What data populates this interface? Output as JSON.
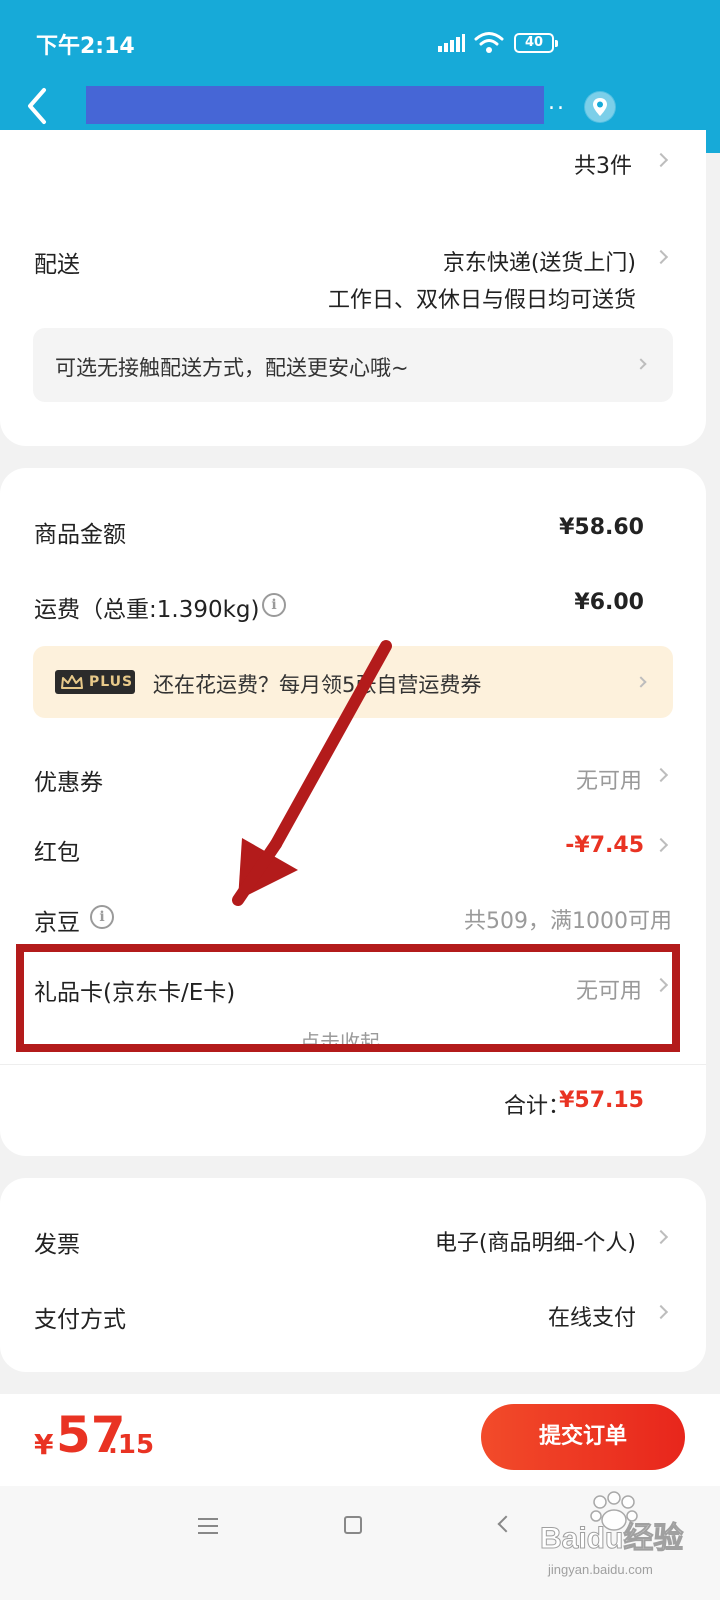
{
  "status_bar": {
    "time": "下午2:14",
    "battery": "40"
  },
  "header": {
    "ellipsis": "..",
    "icons": [
      "back-icon",
      "location-icon"
    ]
  },
  "items_section": {
    "count": "共3件"
  },
  "delivery": {
    "label": "配送",
    "method": "京东快递(送货上门)",
    "schedule": "工作日、双休日与假日均可送货",
    "tip": "可选无接触配送方式，配送更安心哦~"
  },
  "fees": {
    "goods_label": "商品金额",
    "goods_value": "¥58.60",
    "shipping_label": "运费（总重:1.390kg)",
    "shipping_value": "¥6.00",
    "plus_badge": "PLUS",
    "plus_text": "还在花运费？每月领5张自营运费券",
    "coupon_label": "优惠券",
    "coupon_value": "无可用",
    "redpacket_label": "红包",
    "redpacket_value": "-¥7.45",
    "jingdou_label": "京豆",
    "jingdou_value": "共509，满1000可用",
    "giftcard_label": "礼品卡(京东卡/E卡)",
    "giftcard_value": "无可用",
    "collapse_text": "点击收起",
    "total_label": "合计：",
    "total_value": "¥57.15"
  },
  "invoice": {
    "label": "发票",
    "value": "电子(商品明细-个人)",
    "pay_label": "支付方式",
    "pay_value": "在线支付"
  },
  "bottom": {
    "yen": "¥",
    "amount_int": "57",
    "amount_dec": ".15",
    "submit_label": "提交订单"
  },
  "watermark": {
    "brand": "Baidu经验",
    "url": "jingyan.baidu.com"
  },
  "colors": {
    "header": "#17aad8",
    "accent_red": "#e93323",
    "annotation": "#b31b1b"
  }
}
